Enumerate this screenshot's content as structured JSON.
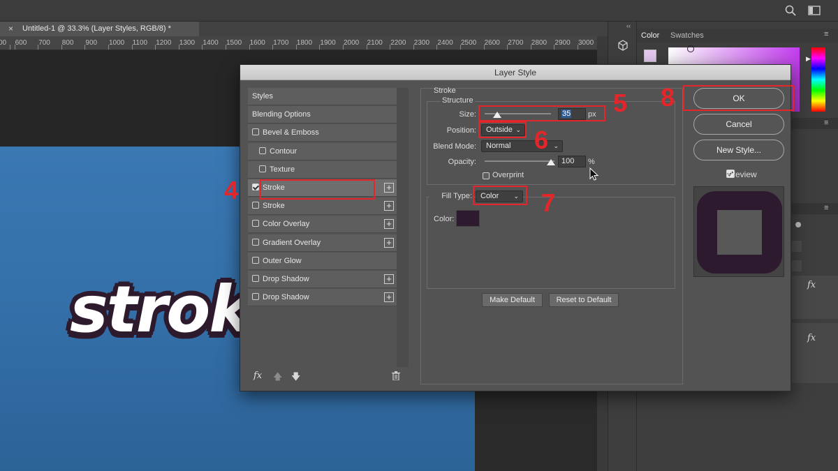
{
  "document_tab": {
    "title": "Untitled-1 @ 33.3% (Layer Styles, RGB/8) *"
  },
  "ruler": {
    "ticks": [
      "00",
      "600",
      "700",
      "800",
      "900",
      "1000",
      "1100",
      "1200",
      "1300",
      "1400",
      "1500",
      "1600",
      "1700",
      "1800",
      "1900",
      "2000",
      "2100",
      "2200",
      "2300",
      "2400",
      "2500",
      "2600",
      "2700",
      "2800",
      "2900",
      "3000"
    ]
  },
  "canvas": {
    "text": "strok"
  },
  "panels": {
    "color_tab": "Color",
    "swatches_tab": "Swatches",
    "fx_1": "fx",
    "fx_2": "fx"
  },
  "dialog": {
    "title": "Layer Style",
    "styles": [
      {
        "label": "Styles",
        "checkbox": false
      },
      {
        "label": "Blending Options",
        "checkbox": false
      },
      {
        "label": "Bevel & Emboss",
        "checkbox": true,
        "checked": false
      },
      {
        "label": "Contour",
        "checkbox": true,
        "checked": false,
        "indent": true
      },
      {
        "label": "Texture",
        "checkbox": true,
        "checked": false,
        "indent": true
      },
      {
        "label": "Stroke",
        "checkbox": true,
        "checked": true,
        "plus": true,
        "selected": true
      },
      {
        "label": "Stroke",
        "checkbox": true,
        "checked": false,
        "plus": true
      },
      {
        "label": "Color Overlay",
        "checkbox": true,
        "checked": false,
        "plus": true
      },
      {
        "label": "Gradient Overlay",
        "checkbox": true,
        "checked": false,
        "plus": true
      },
      {
        "label": "Outer Glow",
        "checkbox": true,
        "checked": false
      },
      {
        "label": "Drop Shadow",
        "checkbox": true,
        "checked": false,
        "plus": true
      },
      {
        "label": "Drop Shadow",
        "checkbox": true,
        "checked": false,
        "plus": true
      }
    ],
    "list_footer": {
      "fx": "fx"
    },
    "stroke": {
      "heading": "Stroke",
      "structure": "Structure",
      "size_label": "Size:",
      "size_value": "35",
      "size_unit": "px",
      "position_label": "Position:",
      "position_value": "Outside",
      "blend_mode_label": "Blend Mode:",
      "blend_mode_value": "Normal",
      "opacity_label": "Opacity:",
      "opacity_value": "100",
      "opacity_unit": "%",
      "overprint_label": "Overprint",
      "fill_type_label": "Fill Type:",
      "fill_type_value": "Color",
      "color_label": "Color:",
      "color_value": "#2e1a2e"
    },
    "make_default": "Make Default",
    "reset_default": "Reset to Default",
    "ok": "OK",
    "cancel": "Cancel",
    "new_style": "New Style...",
    "preview_label": "Preview",
    "preview_checked": true
  },
  "annotations": [
    "4",
    "5",
    "6",
    "7",
    "8"
  ],
  "colors": {
    "accent_red": "#e4262b",
    "stroke_color": "#2e1a2e",
    "canvas_blue": "#3572ad"
  }
}
